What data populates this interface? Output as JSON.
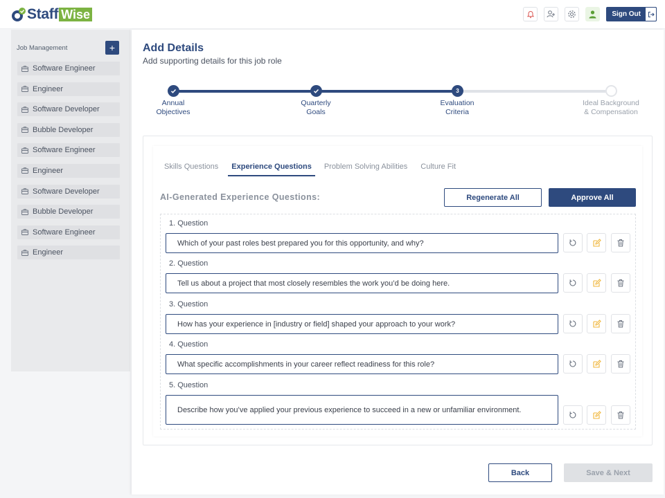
{
  "brand": {
    "name_left": "Staff",
    "name_right": "Wise",
    "primary": "#2e4a7e",
    "accent": "#7cb342"
  },
  "header": {
    "icons": [
      "bell-icon",
      "add-user-icon",
      "gear-icon",
      "user-avatar-icon"
    ],
    "sign_out_label": "Sign Out"
  },
  "sidebar": {
    "title": "Job Management",
    "add_label": "+",
    "items": [
      {
        "label": "Software Engineer"
      },
      {
        "label": "Engineer"
      },
      {
        "label": "Software Developer"
      },
      {
        "label": "Bubble Developer"
      },
      {
        "label": "Software Engineer"
      },
      {
        "label": "Engineer"
      },
      {
        "label": "Software Developer"
      },
      {
        "label": "Bubble Developer"
      },
      {
        "label": "Software Engineer"
      },
      {
        "label": "Engineer"
      }
    ]
  },
  "page": {
    "title": "Add Details",
    "subtitle": "Add supporting details for this job role"
  },
  "stepper": {
    "steps": [
      {
        "line1": "Annual",
        "line2": "Objectives",
        "state": "complete"
      },
      {
        "line1": "Quarterly",
        "line2": "Goals",
        "state": "complete"
      },
      {
        "line1": "Evaluation",
        "line2": "Criteria",
        "state": "current",
        "number": "3"
      },
      {
        "line1": "Ideal Background",
        "line2": "& Compensation",
        "state": "pending"
      }
    ]
  },
  "tabs": [
    {
      "label": "Skills Questions",
      "active": false
    },
    {
      "label": "Experience Questions",
      "active": true
    },
    {
      "label": "Problem Solving Abilities",
      "active": false
    },
    {
      "label": "Culture Fit",
      "active": false
    }
  ],
  "questions_section": {
    "title": "AI-Generated Experience Questions:",
    "regenerate_label": "Regenerate All",
    "approve_label": "Approve All",
    "questions": [
      {
        "label": "1. Question",
        "text": "Which of your past roles best prepared you for this opportunity, and why?"
      },
      {
        "label": "2. Question",
        "text": "Tell us about a project that most closely resembles the work you’d be doing here."
      },
      {
        "label": "3. Question",
        "text": "How has your experience in [industry or field] shaped your approach to your work?"
      },
      {
        "label": "4. Question",
        "text": "What specific accomplishments in your career reflect readiness for this role?"
      },
      {
        "label": "5. Question",
        "text": "Describe how you’ve applied your previous experience to succeed in a new or unfamiliar environment."
      }
    ],
    "action_icons": [
      "regenerate-icon",
      "edit-icon",
      "delete-icon"
    ]
  },
  "footer": {
    "back_label": "Back",
    "next_label": "Save & Next"
  }
}
